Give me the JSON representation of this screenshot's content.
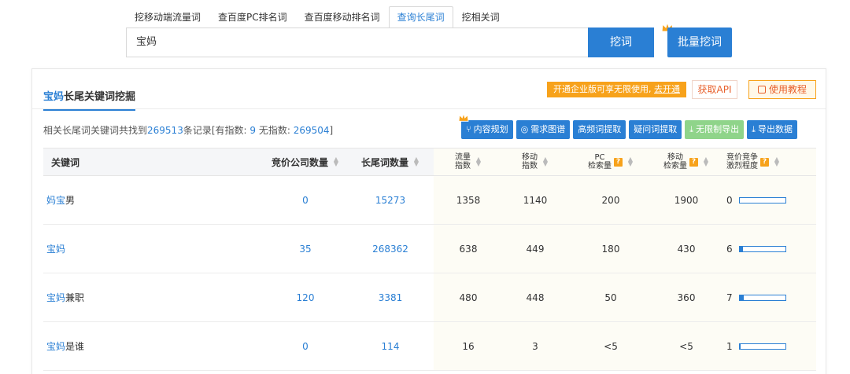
{
  "tabs": [
    {
      "label": "挖移动端流量词",
      "active": false
    },
    {
      "label": "查百度PC排名词",
      "active": false
    },
    {
      "label": "查百度移动排名词",
      "active": false
    },
    {
      "label": "查询长尾词",
      "active": true
    },
    {
      "label": "挖相关词",
      "active": false
    }
  ],
  "search": {
    "value": "宝妈",
    "dig_label": "挖词",
    "batch_label": "批量挖词"
  },
  "panel": {
    "title_kw": "宝妈",
    "title_rest": "长尾关键词挖掘",
    "promo_text": "开通企业版可享无限使用, ",
    "promo_link": "去开通",
    "api_label": "获取API",
    "tutorial_label": "使用教程"
  },
  "summary": {
    "prefix": "相关长尾词关键词共找到",
    "total": "269513",
    "mid": "条记录[有指数: ",
    "with_index": "9",
    "mid2": " 无指数: ",
    "no_index": "269504",
    "suffix": "]"
  },
  "actions": [
    {
      "label": "内容规划",
      "icon": "share-icon"
    },
    {
      "label": "需求图谱",
      "icon": "eye-icon"
    },
    {
      "label": "高频词提取",
      "icon": ""
    },
    {
      "label": "疑问词提取",
      "icon": ""
    },
    {
      "label": "无限制导出",
      "icon": "download-icon"
    },
    {
      "label": "导出数据",
      "icon": "download-icon"
    }
  ],
  "columns": {
    "keyword": "关键词",
    "bid_companies": "竞价公司数量",
    "longtail_count": "长尾词数量",
    "traffic_1": "流量",
    "traffic_2": "指数",
    "mobile_1": "移动",
    "mobile_2": "指数",
    "pc_1": "PC",
    "pc_2": "检索量",
    "msearch_1": "移动",
    "msearch_2": "检索量",
    "compete_1": "竞价竞争",
    "compete_2": "激烈程度"
  },
  "rows": [
    {
      "kw_blue": "妈宝",
      "kw_rest": "男",
      "bid": "0",
      "longtail": "15273",
      "traffic": "1358",
      "mobile": "1140",
      "pc": "200",
      "msearch": "1900",
      "compete": "0",
      "compete_level": 0.0
    },
    {
      "kw_blue": "宝妈",
      "kw_rest": "",
      "bid": "35",
      "longtail": "268362",
      "traffic": "638",
      "mobile": "449",
      "pc": "180",
      "msearch": "430",
      "compete": "6",
      "compete_level": 0.08
    },
    {
      "kw_blue": "宝妈",
      "kw_rest": "兼职",
      "bid": "120",
      "longtail": "3381",
      "traffic": "480",
      "mobile": "448",
      "pc": "50",
      "msearch": "360",
      "compete": "7",
      "compete_level": 0.1
    },
    {
      "kw_blue": "宝妈",
      "kw_rest": "是谁",
      "bid": "0",
      "longtail": "114",
      "traffic": "16",
      "mobile": "3",
      "pc": "<5",
      "msearch": "<5",
      "compete": "1",
      "compete_level": 0.02
    }
  ]
}
